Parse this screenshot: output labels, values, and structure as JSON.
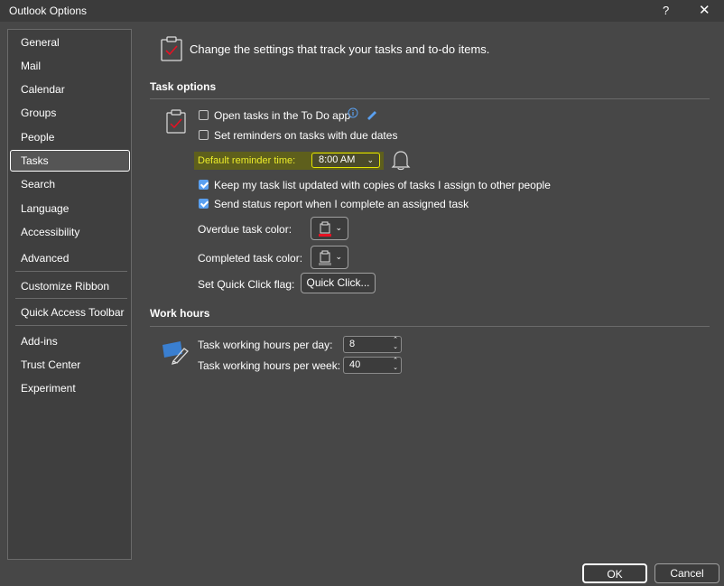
{
  "window": {
    "title": "Outlook Options",
    "help": "?",
    "close": "✕"
  },
  "sidebar": {
    "items": [
      {
        "label": "General"
      },
      {
        "label": "Mail"
      },
      {
        "label": "Calendar"
      },
      {
        "label": "Groups"
      },
      {
        "label": "People"
      },
      {
        "label": "Tasks"
      },
      {
        "label": "Search"
      },
      {
        "label": "Language"
      },
      {
        "label": "Accessibility"
      },
      {
        "label": "Advanced"
      },
      {
        "label": "Customize Ribbon"
      },
      {
        "label": "Quick Access Toolbar"
      },
      {
        "label": "Add-ins"
      },
      {
        "label": "Trust Center"
      },
      {
        "label": "Experiment"
      }
    ],
    "selected": "Tasks"
  },
  "header": {
    "text": "Change the settings that track your tasks and to-do items."
  },
  "task_options": {
    "title": "Task options",
    "open_todo": {
      "label": "Open tasks in the To Do app",
      "checked": false
    },
    "set_reminders": {
      "label": "Set reminders on tasks with due dates",
      "checked": false
    },
    "default_reminder": {
      "label": "Default reminder time:",
      "value": "8:00 AM"
    },
    "keep_updated": {
      "label": "Keep my task list updated with copies of tasks I assign to other people",
      "checked": true
    },
    "send_status": {
      "label": "Send status report when I complete an assigned task",
      "checked": true
    },
    "overdue_color": {
      "label": "Overdue task color:",
      "color": "#e81123"
    },
    "completed_color": {
      "label": "Completed task color:",
      "color": "#808080"
    },
    "quick_click": {
      "label": "Set Quick Click flag:",
      "button": "Quick Click..."
    }
  },
  "work_hours": {
    "title": "Work hours",
    "per_day": {
      "label": "Task working hours per day:",
      "value": "8"
    },
    "per_week": {
      "label": "Task working hours per week:",
      "value": "40"
    }
  },
  "footer": {
    "ok": "OK",
    "cancel": "Cancel"
  },
  "colors": {
    "accent": "#5aa0f0",
    "highlight": "#e6e600"
  }
}
